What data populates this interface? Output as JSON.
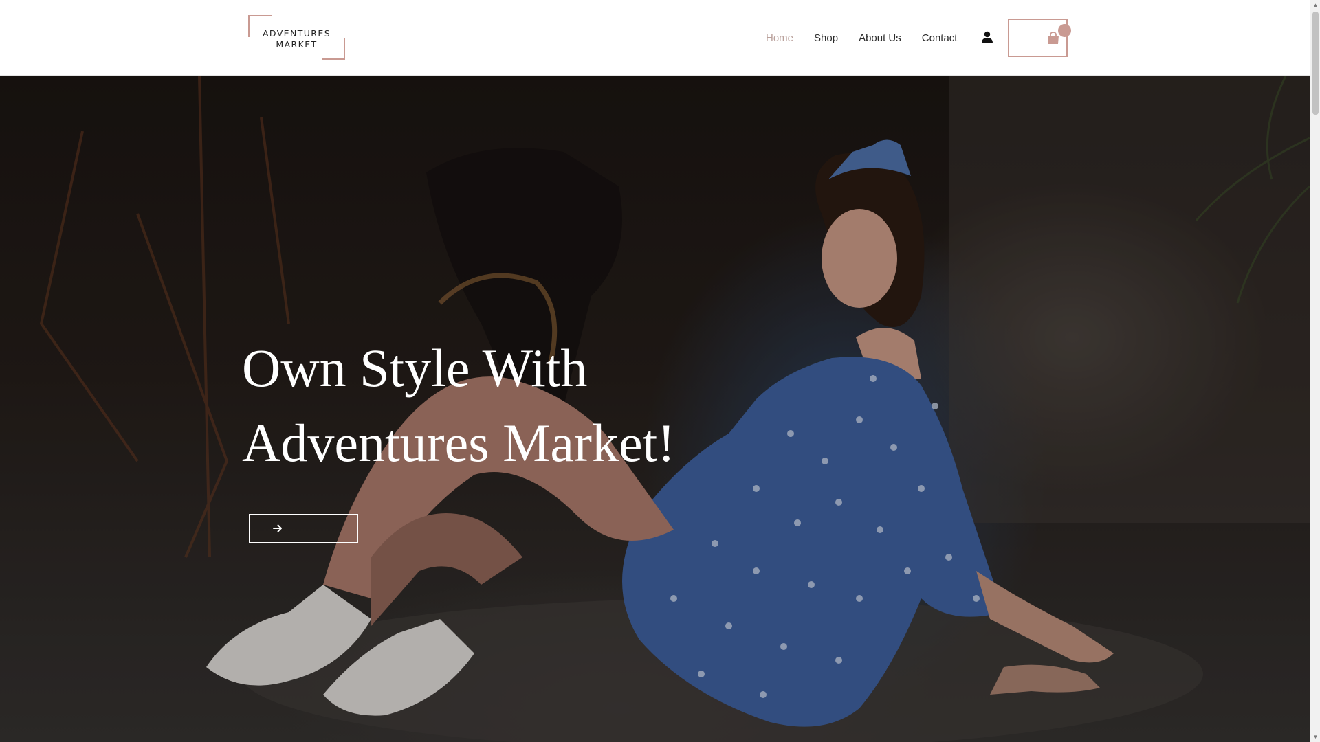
{
  "brand": {
    "logo_line1": "ADVENTURES",
    "logo_line2": "MARKET",
    "accent_color": "#c99a92"
  },
  "nav": {
    "items": [
      {
        "label": "Home",
        "active": true
      },
      {
        "label": "Shop",
        "active": false
      },
      {
        "label": "About Us",
        "active": false
      },
      {
        "label": "Contact",
        "active": false
      }
    ],
    "active_color": "#b9a09b"
  },
  "header_icons": {
    "account": "user-icon",
    "cart": "shopping-bag-icon"
  },
  "hero": {
    "title_line1": "Own Style With",
    "title_line2": "Adventures Market!",
    "button_icon": "arrow-right-icon"
  },
  "scrollbar": {
    "up": "▲",
    "down": "▼"
  }
}
